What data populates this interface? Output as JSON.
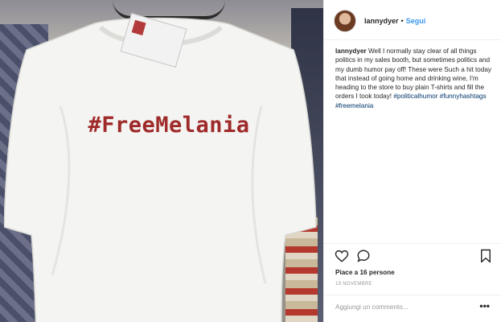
{
  "post": {
    "username": "lannydyer",
    "separator": "•",
    "follow_label": "Segui",
    "caption_username": "lannydyer",
    "caption_text": "Well I normally stay clear of all things politics in my sales booth, but sometimes politics and my dumb humor pay off! These were Such a hit today that instead of going home and drinking wine, I'm heading to the store to buy plain T-shirts and fill the orders I took today!",
    "hashtags": [
      "#politicalhumor",
      "#funnyhashtags",
      "#freemelania"
    ],
    "likes_text": "Piace a 16 persone",
    "date_text": "19 NOVEMBRE",
    "comment_placeholder": "Aggiungi un commento...",
    "more_label": "•••"
  },
  "photo": {
    "shirt_text": "#FreeMelania"
  },
  "icons": {
    "like": "heart-icon",
    "comment": "comment-icon",
    "save": "bookmark-icon"
  },
  "colors": {
    "link": "#3897f0",
    "hashtag": "#003569",
    "text": "#262626",
    "muted": "#999999",
    "shirt_print": "#9f2a2a"
  }
}
